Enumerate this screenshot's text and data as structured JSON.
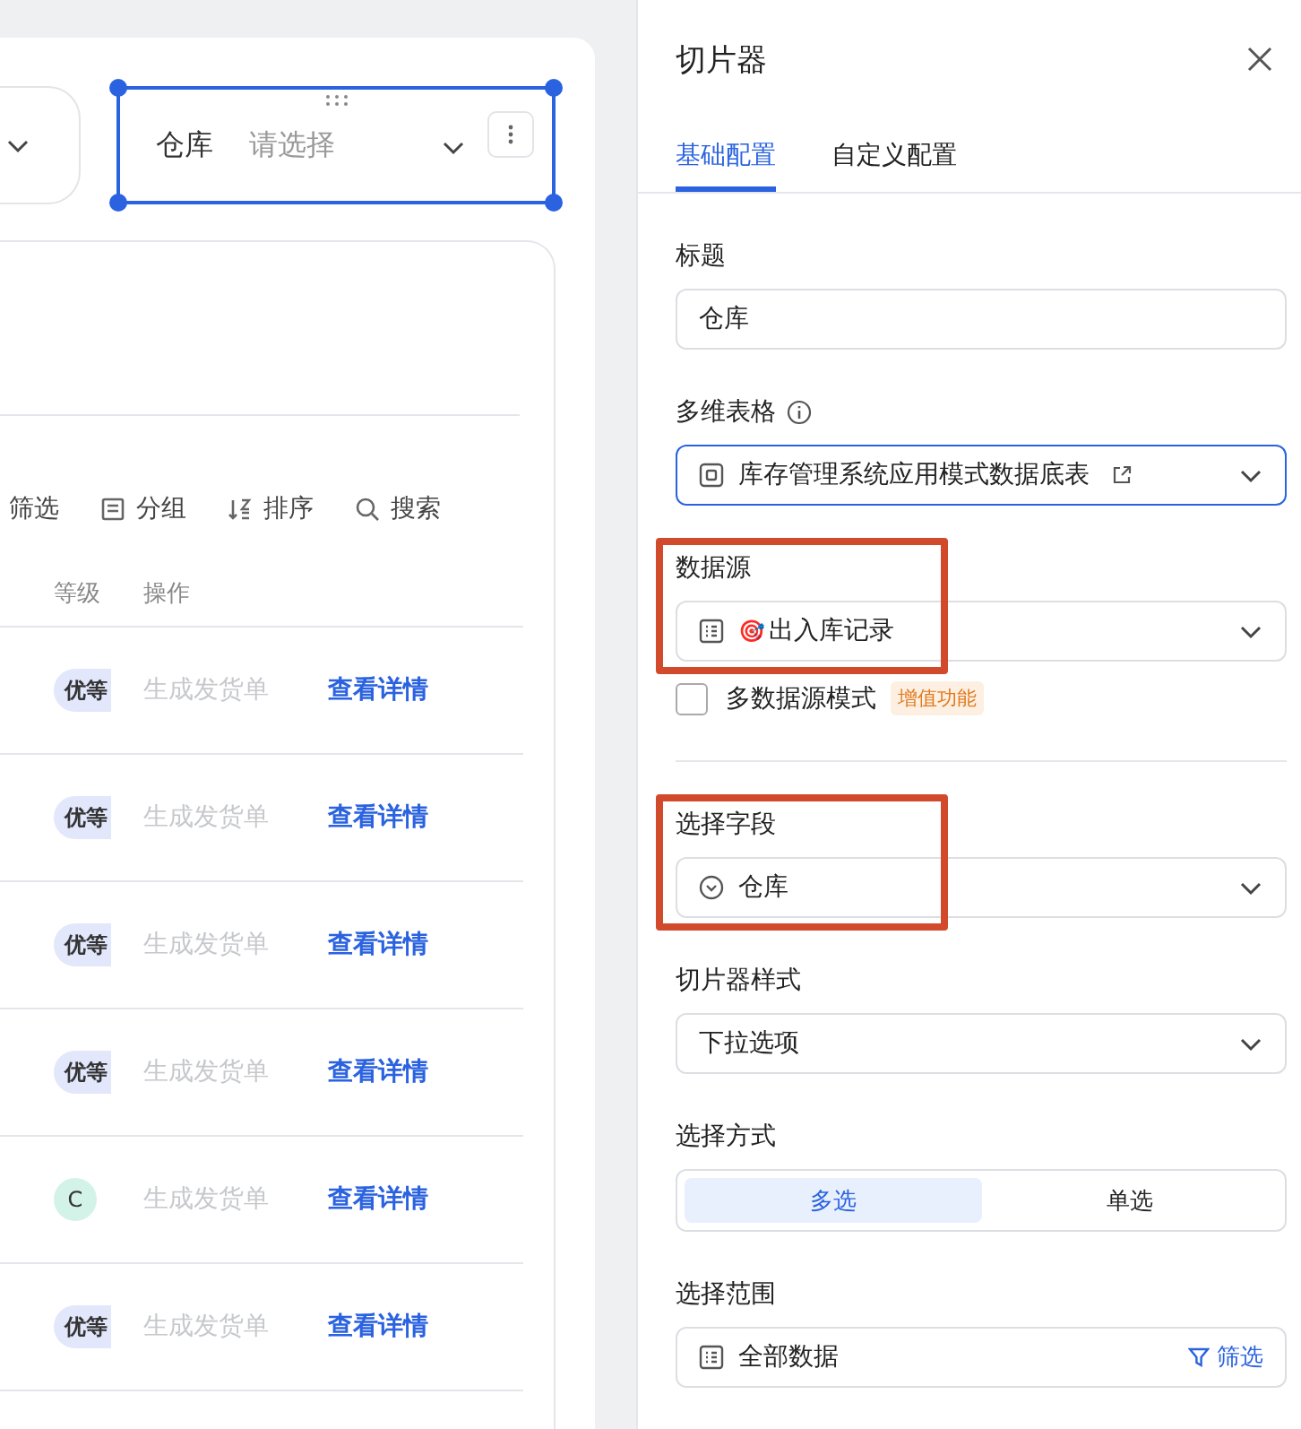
{
  "canvas": {
    "slicer": {
      "title": "仓库",
      "placeholder": "请选择",
      "selected": true
    },
    "toolbar": [
      {
        "label": "筛选"
      },
      {
        "kind": "group",
        "label": "分组"
      },
      {
        "kind": "sort",
        "label": "排序"
      },
      {
        "kind": "search",
        "label": "搜索"
      }
    ],
    "columns": [
      "等级",
      "操作"
    ],
    "rows": [
      {
        "grade": {
          "kind": "pill",
          "text": "优等",
          "color": "#e2e7fb"
        },
        "action": {
          "text": "生成发货单",
          "disabled": true
        },
        "link": "查看详情"
      },
      {
        "grade": {
          "kind": "pill",
          "text": "优等",
          "color": "#e2e7fb"
        },
        "action": {
          "text": "生成发货单",
          "disabled": true
        },
        "link": "查看详情"
      },
      {
        "grade": {
          "kind": "pill",
          "text": "优等",
          "color": "#e2e7fb"
        },
        "action": {
          "text": "生成发货单",
          "disabled": true
        },
        "link": "查看详情"
      },
      {
        "grade": {
          "kind": "pill",
          "text": "优等",
          "color": "#e2e7fb"
        },
        "action": {
          "text": "生成发货单",
          "disabled": true
        },
        "link": "查看详情"
      },
      {
        "grade": {
          "kind": "circle",
          "text": "C",
          "color": "#d3f3e8"
        },
        "action": {
          "text": "生成发货单",
          "disabled": true
        },
        "link": "查看详情"
      },
      {
        "grade": {
          "kind": "pill",
          "text": "优等",
          "color": "#e2e7fb"
        },
        "action": {
          "text": "生成发货单",
          "disabled": true
        },
        "link": "查看详情"
      }
    ]
  },
  "panel": {
    "title": "切片器",
    "tabs": [
      {
        "label": "基础配置",
        "selected": true
      },
      {
        "label": "自定义配置",
        "selected": false
      }
    ],
    "sections": [
      {
        "kind": "input",
        "label": "标题",
        "value": "仓库",
        "highlighted": false
      },
      {
        "kind": "select",
        "label": "多维表格",
        "info": true,
        "value": "库存管理系统应用模式数据底表",
        "external": true,
        "focused": true,
        "highlighted": false
      },
      {
        "kind": "select",
        "label": "数据源",
        "emoji": "🎯",
        "value": "出入库记录",
        "focused": false,
        "highlighted": true
      },
      {
        "kind": "checkbox",
        "label": "多数据源模式",
        "checked": false,
        "badge": "增值功能"
      },
      {
        "kind": "divider"
      },
      {
        "kind": "select",
        "label": "选择字段",
        "value": "仓库",
        "focused": false,
        "highlighted": true
      },
      {
        "kind": "select",
        "label": "切片器样式",
        "value": "下拉选项",
        "focused": false,
        "highlighted": false
      },
      {
        "kind": "segmented",
        "label": "选择方式",
        "options": [
          {
            "label": "多选",
            "selected": true
          },
          {
            "label": "单选",
            "selected": false
          }
        ]
      },
      {
        "kind": "range",
        "label": "选择范围",
        "value": "全部数据",
        "action": "筛选"
      }
    ]
  }
}
